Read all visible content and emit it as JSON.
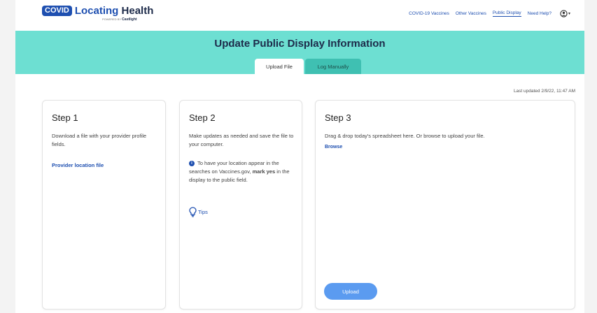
{
  "header": {
    "logo_badge": "COVID",
    "logo_text_1": "Locating",
    "logo_text_2": "Health",
    "logo_sub_prefix": "POWERED BY",
    "logo_sub_brand": "Castlight",
    "nav": [
      {
        "label": "COVID-19 Vaccines"
      },
      {
        "label": "Other Vaccines"
      },
      {
        "label": "Public Display"
      },
      {
        "label": "Need Help?"
      }
    ],
    "user_icon": "user-account-icon"
  },
  "banner": {
    "title": "Update Public Display Information",
    "tabs": [
      {
        "label": "Upload File"
      },
      {
        "label": "Log Manually"
      }
    ],
    "color": "#6ddfd2"
  },
  "last_updated": "Last updated 2/9/22, 11:47 AM",
  "steps": {
    "step1": {
      "title": "Step 1",
      "text": "Download a file with your provider profile fields.",
      "link": "Provider location file"
    },
    "step2": {
      "title": "Step 2",
      "text": "Make updates as needed and save the file to your computer.",
      "info_pre": "To have your location appear in the searches on Vaccines.gov,",
      "info_bold": "mark yes",
      "info_post": "in the display to the public field.",
      "tips": "Tips"
    },
    "step3": {
      "title": "Step 3",
      "text": "Drag & drop today's spreadsheet here. Or browse to upload your file.",
      "browse": "Browse",
      "upload": "Upload"
    }
  },
  "colors": {
    "brand_blue": "#1e4fb0",
    "teal": "#6ddfd2",
    "button": "#5b9bf0"
  }
}
